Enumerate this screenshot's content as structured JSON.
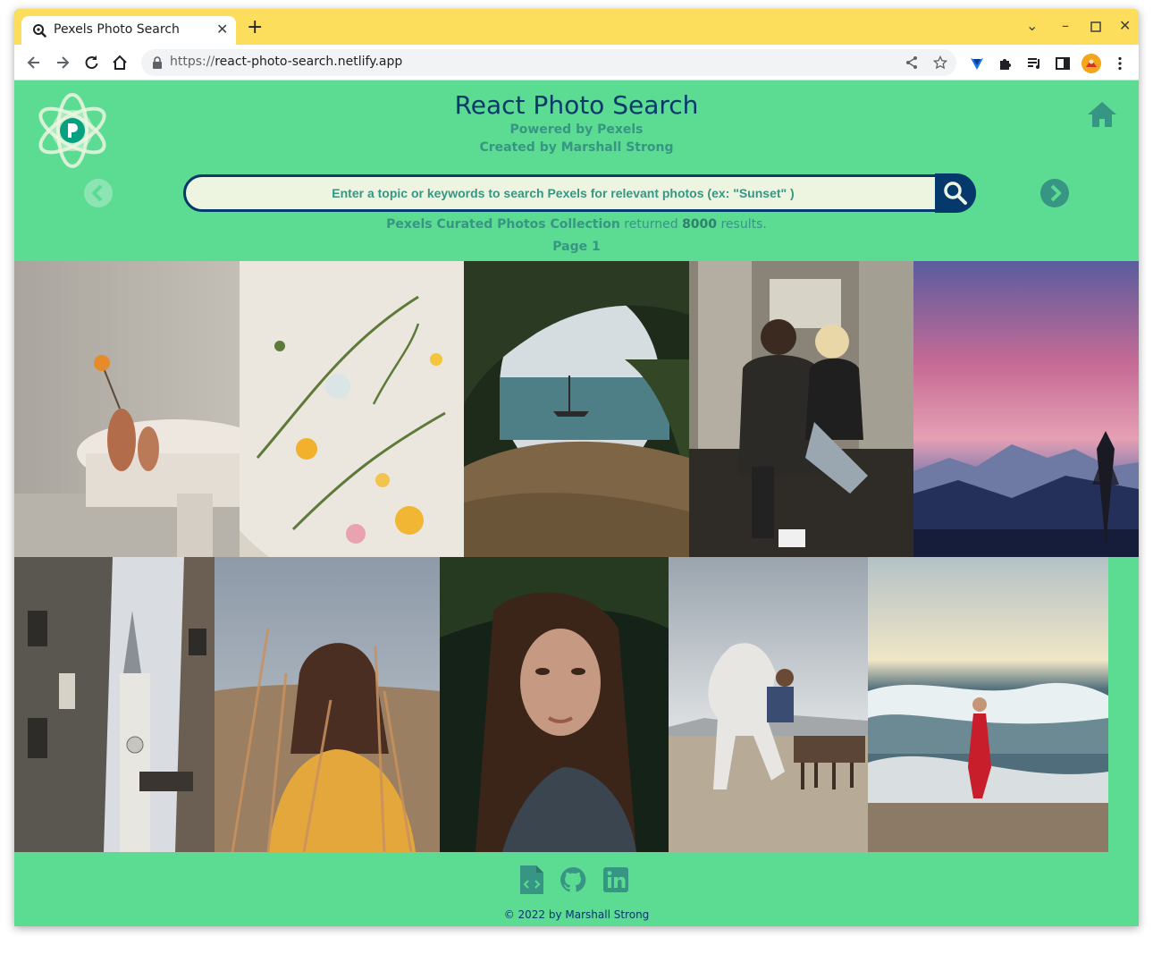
{
  "browser": {
    "tab_title": "Pexels Photo Search",
    "url_scheme": "https://",
    "url_host": "react-photo-search.netlify.app",
    "tab_strip_color": "#fddd5c"
  },
  "app": {
    "title": "React Photo Search",
    "powered_by": "Powered by Pexels",
    "created_by": "Created by Marshall Strong",
    "search_placeholder": "Enter a topic or keywords to search Pexels for relevant photos (ex: \"Sunset\" )",
    "result_collection": "Pexels Curated Photos Collection",
    "result_mid": " returned ",
    "result_count": "8000",
    "result_suffix": " results.",
    "page_label": "Page 1",
    "colors": {
      "background": "#5cdb92",
      "navy": "#05386b",
      "teal": "#379683",
      "input_bg": "#edf5e1"
    }
  },
  "photos": [
    {
      "name": "photo-vase-flower",
      "icon": "photo"
    },
    {
      "name": "photo-flowers-table",
      "icon": "photo"
    },
    {
      "name": "photo-lake-boat",
      "icon": "photo"
    },
    {
      "name": "photo-subway-couple",
      "icon": "photo"
    },
    {
      "name": "photo-pink-sky-mountains",
      "icon": "photo"
    },
    {
      "name": "photo-church-street",
      "icon": "photo"
    },
    {
      "name": "photo-woman-reeds",
      "icon": "photo"
    },
    {
      "name": "photo-woman-portrait",
      "icon": "photo"
    },
    {
      "name": "photo-horse-rider",
      "icon": "photo"
    },
    {
      "name": "photo-woman-sea",
      "icon": "photo"
    }
  ],
  "footer": {
    "copyright": "© 2022 by Marshall Strong",
    "icons": [
      "code-file-icon",
      "github-icon",
      "linkedin-icon"
    ]
  }
}
